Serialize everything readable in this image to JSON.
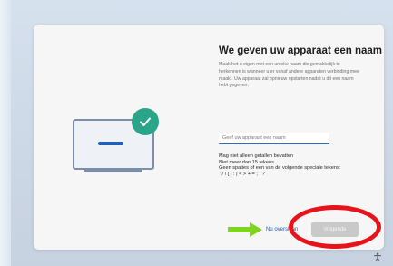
{
  "oobe": {
    "title": "We geven uw apparaat een naam",
    "description": "Maak het u eigen met een unieke naam die gemakkelijk te herkennen is wanneer u er vanaf andere apparaten verbinding mee maakt. Uw apparaat zal opnieuw opstarten nadat u dit een naam hebt gegeven.",
    "input": {
      "placeholder": "Geef uw apparaat een naam",
      "value": ""
    },
    "rules": [
      "Mag niet alleen getallen bevatten",
      "Niet meer dan 15 tekens",
      "Geen spaties of een van de volgende speciale tekens:",
      "\" / \\ [ ] : | < > + = ; , ?"
    ],
    "skip_label": "Nu overslaan",
    "next_label": "Volgende"
  },
  "icons": {
    "check": "checkmark-icon",
    "device": "laptop-icon",
    "arrow": "arrow-right-icon",
    "accessibility": "accessibility-icon"
  },
  "colors": {
    "accent": "#1f5fb5",
    "check_badge": "#2aa58a",
    "arrow": "#7fd321",
    "annotation_circle": "#e8131a",
    "next_disabled": "#c9c9c9"
  }
}
